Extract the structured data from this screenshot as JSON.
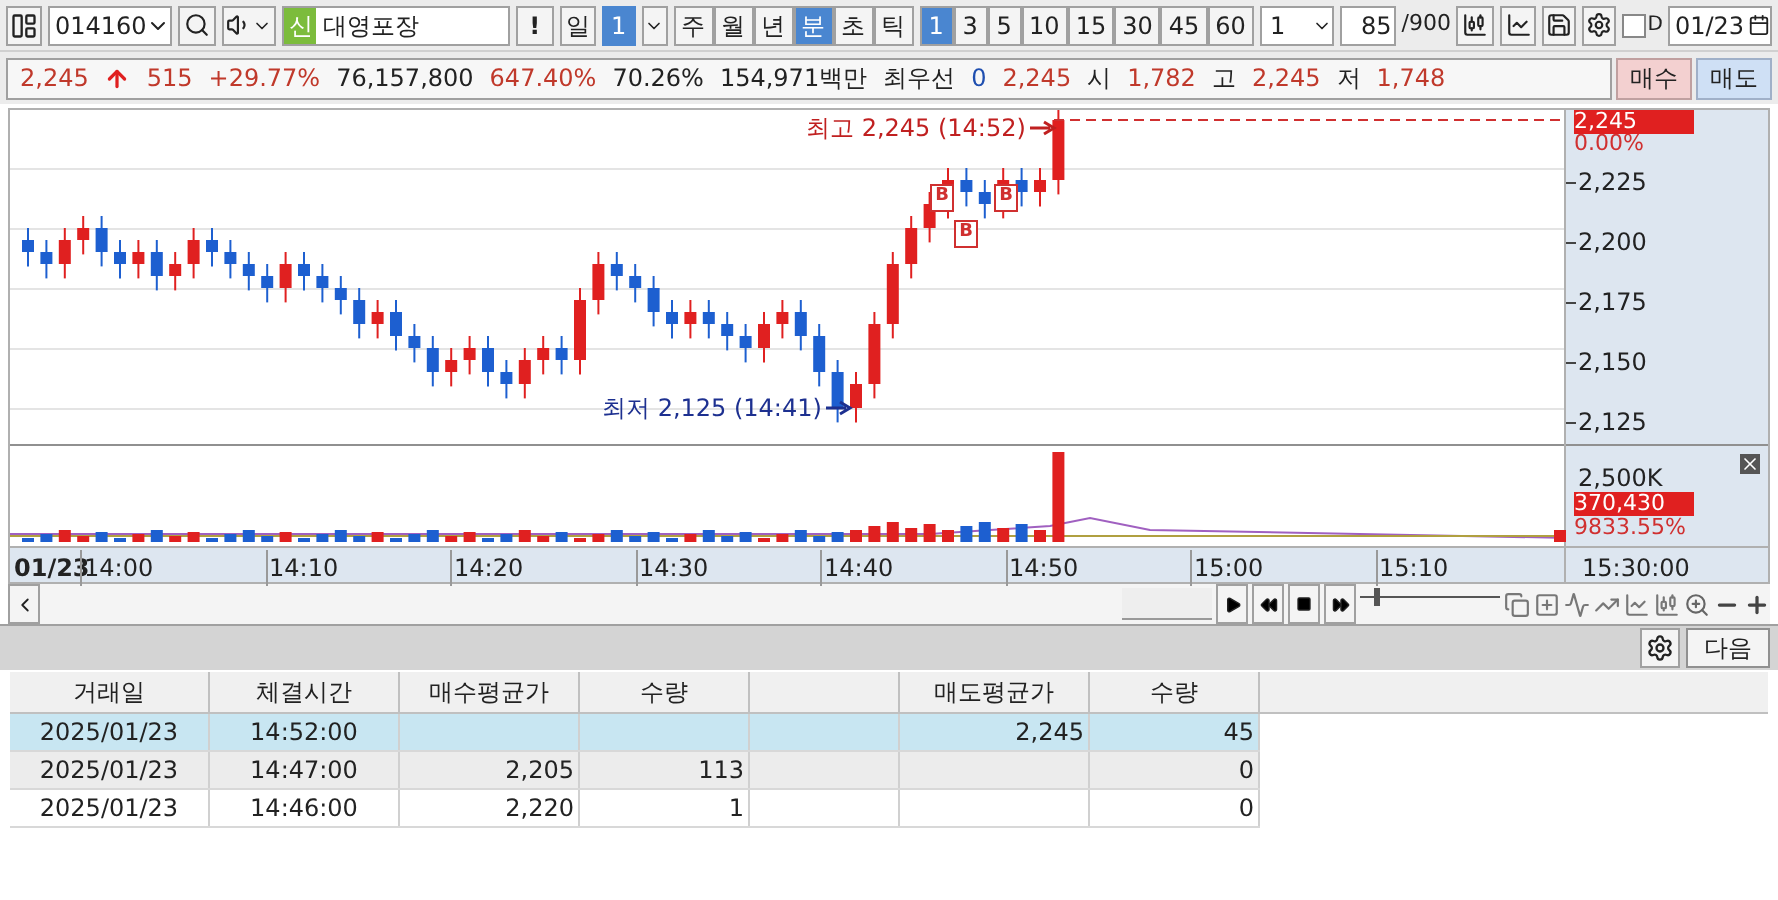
{
  "toolbar": {
    "code": "014160",
    "badge": "신",
    "name": "대영포장",
    "alert": "!",
    "day": {
      "label": "일",
      "count": "1"
    },
    "periods": [
      {
        "label": "주",
        "selected": false
      },
      {
        "label": "월",
        "selected": false
      },
      {
        "label": "년",
        "selected": false
      },
      {
        "label": "분",
        "selected": true
      },
      {
        "label": "초",
        "selected": false
      },
      {
        "label": "틱",
        "selected": false
      }
    ],
    "intervals": [
      {
        "label": "1",
        "selected": true
      },
      {
        "label": "3",
        "selected": false
      },
      {
        "label": "5",
        "selected": false
      },
      {
        "label": "10",
        "selected": false
      },
      {
        "label": "15",
        "selected": false
      },
      {
        "label": "30",
        "selected": false
      },
      {
        "label": "45",
        "selected": false
      },
      {
        "label": "60",
        "selected": false
      }
    ],
    "unit": "1",
    "count": "85",
    "count_total": "/900",
    "d_checkbox": {
      "label": "D",
      "checked": false
    },
    "date": "01/23"
  },
  "quote": [
    {
      "text": "2,245",
      "color": "#c0392b"
    },
    {
      "text": "515",
      "color": "#c0392b"
    },
    {
      "text": "+29.77%",
      "color": "#c0392b"
    },
    {
      "text": "76,157,800",
      "color": "#222222"
    },
    {
      "text": "647.40%",
      "color": "#c0392b"
    },
    {
      "text": "70.26%",
      "color": "#222222"
    },
    {
      "text": "154,971백만",
      "color": "#222222"
    },
    {
      "text": "최우선",
      "color": "#222222"
    },
    {
      "text": "0",
      "color": "#1f4fb0"
    },
    {
      "text": "2,245",
      "color": "#c0392b"
    },
    {
      "text": "시",
      "color": "#222222"
    },
    {
      "text": "1,782",
      "color": "#c0392b"
    },
    {
      "text": "고",
      "color": "#222222"
    },
    {
      "text": "2,245",
      "color": "#c0392b"
    },
    {
      "text": "저",
      "color": "#222222"
    },
    {
      "text": "1,748",
      "color": "#c0392b"
    }
  ],
  "buy_button": "매수",
  "sell_button": "매도",
  "chart": {
    "high_label": "최고 2,245 (14:52)",
    "low_label": "최저 2,125 (14:41)",
    "markers": [
      {
        "label": "B"
      },
      {
        "label": "B"
      },
      {
        "label": "B"
      }
    ],
    "price_badge": "2,245",
    "price_change": "0.00%",
    "yticks": [
      "2,225",
      "2,200",
      "2,175",
      "2,150",
      "2,125"
    ],
    "volume_tick": "2,500K",
    "volume_badge": "370,430",
    "volume_ratio": "9833.55%",
    "date_label": "01/23",
    "times": [
      "14:00",
      "14:10",
      "14:20",
      "14:30",
      "14:40",
      "14:50",
      "15:00",
      "15:10"
    ],
    "end_time": "15:30:00"
  },
  "playback": {
    "level": 0.1
  },
  "actions": {
    "next": "다음"
  },
  "table": {
    "columns": [
      "거래일",
      "체결시간",
      "매수평균가",
      "수량",
      "",
      "매도평균가",
      "수량"
    ],
    "rows": [
      {
        "cells": [
          "2025/01/23",
          "14:52:00",
          "",
          "",
          "",
          "2,245",
          "45"
        ],
        "selected": true
      },
      {
        "cells": [
          "2025/01/23",
          "14:47:00",
          "2,205",
          "113",
          "",
          "",
          "0"
        ],
        "selected": false
      },
      {
        "cells": [
          "2025/01/23",
          "14:46:00",
          "2,220",
          "1",
          "",
          "",
          "0"
        ],
        "selected": false
      }
    ]
  }
}
